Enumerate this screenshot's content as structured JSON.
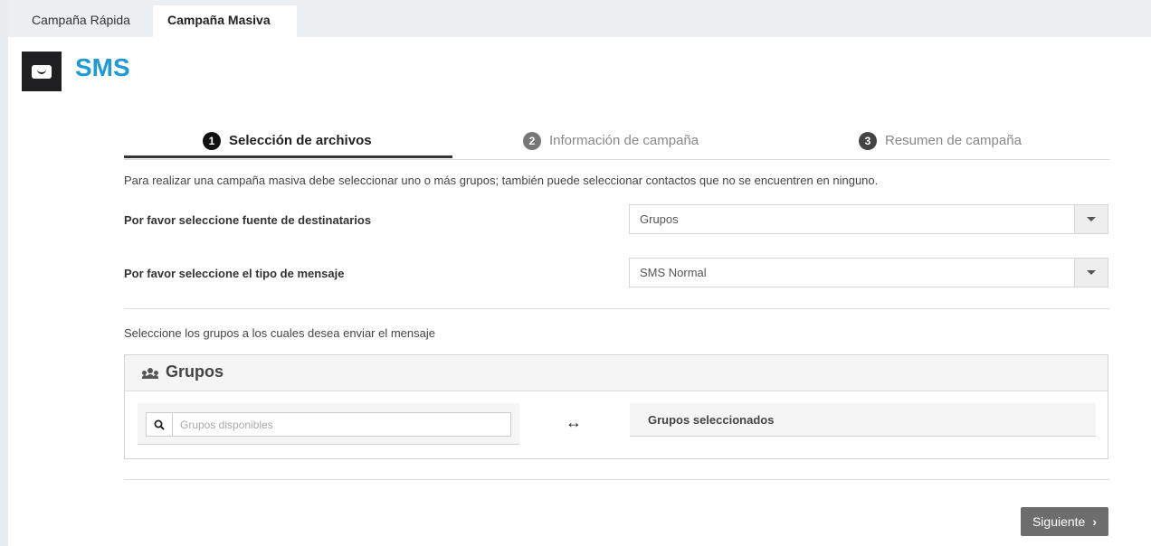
{
  "tabs": [
    {
      "label": "Campaña Rápida",
      "active": false
    },
    {
      "label": "Campaña Masiva",
      "active": true
    }
  ],
  "header": {
    "title": "SMS",
    "icon": "message-icon"
  },
  "steps": [
    {
      "number": "1",
      "label": "Selección de archivos",
      "active": true
    },
    {
      "number": "2",
      "label": "Información de campaña",
      "active": false
    },
    {
      "number": "3",
      "label": "Resumen de campaña",
      "active": false
    }
  ],
  "intro_text": "Para realizar una campaña masiva debe seleccionar uno o más grupos; también puede seleccionar contactos que no se encuentren en ninguno.",
  "form": {
    "source_label": "Por favor seleccione fuente de destinatarios",
    "source_value": "Grupos",
    "type_label": "Por favor seleccione el tipo de mensaje",
    "type_value": "SMS Normal"
  },
  "groups_prompt": "Seleccione los grupos a los cuales desea enviar el mensaje",
  "groups_panel": {
    "title": "Grupos",
    "search_placeholder": "Grupos disponibles",
    "transfer_icon": "↔",
    "selected_title": "Grupos seleccionados"
  },
  "next_button": {
    "label": "Siguiente",
    "chevron": "›"
  },
  "colors": {
    "accent": "#1e9ad6",
    "button": "#6d6d6d"
  }
}
